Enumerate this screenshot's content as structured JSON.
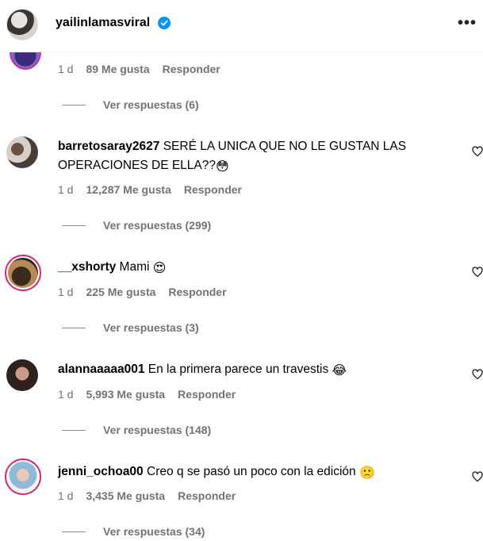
{
  "header": {
    "username": "yailinlamasviral",
    "more_icon": "•••"
  },
  "top_partial": {
    "time": "1 d",
    "likes": "89 Me gusta",
    "reply": "Responder",
    "view_replies": "Ver respuestas (6)"
  },
  "comments": [
    {
      "user": "barretosaray2627",
      "text": "SERÉ LA UNICA QUE NO LE GUSTAN LAS OPERACIONES DE ELLA??",
      "emoji": "😳",
      "time": "1 d",
      "likes": "12,287 Me gusta",
      "reply": "Responder",
      "view_replies": "Ver respuestas (299)"
    },
    {
      "user": "__xshorty",
      "text": "Mami",
      "emoji": "😍",
      "time": "1 d",
      "likes": "225 Me gusta",
      "reply": "Responder",
      "view_replies": "Ver respuestas (3)"
    },
    {
      "user": "alannaaaaa001",
      "text": "En la primera parece un travestis",
      "emoji": "😂",
      "time": "1 d",
      "likes": "5,993 Me gusta",
      "reply": "Responder",
      "view_replies": "Ver respuestas (148)"
    },
    {
      "user": "jenni_ochoa00",
      "text": "Creo q se pasó un poco con la edición",
      "emoji": "🙁",
      "time": "1 d",
      "likes": "3,435 Me gusta",
      "reply": "Responder",
      "view_replies": "Ver respuestas (34)"
    }
  ],
  "colors": {
    "meta_text": "#737373",
    "verified_blue": "#0095f6",
    "story_ring": "#d62976"
  }
}
